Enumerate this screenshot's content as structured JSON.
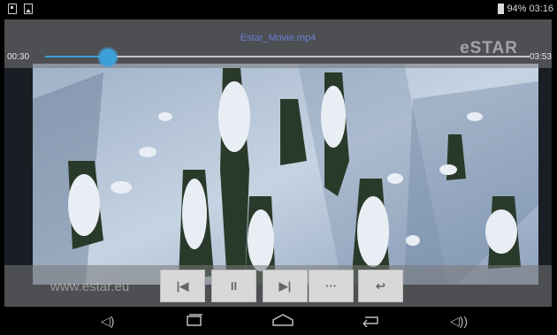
{
  "status_bar": {
    "battery": "94%",
    "time": "03:16",
    "left_icons": [
      "storage-icon",
      "image-icon"
    ]
  },
  "player": {
    "file_title": "Estar_Movie.mp4",
    "current_time": "00:30",
    "total_time": "03:53",
    "progress": 0.13,
    "logo_text": "eSTAR"
  },
  "controls": {
    "site": "www.estar.eu",
    "buttons": [
      {
        "name": "previous-button",
        "icon": "skip-previous-icon",
        "glyph": "|◀"
      },
      {
        "name": "pause-button",
        "icon": "pause-icon",
        "glyph": "II"
      },
      {
        "name": "next-button",
        "icon": "skip-next-icon",
        "glyph": "▶|"
      },
      {
        "name": "more-button",
        "icon": "more-icon",
        "glyph": "···"
      },
      {
        "name": "back-button",
        "icon": "return-icon",
        "glyph": "↩"
      }
    ]
  },
  "nav_bar": {
    "icons": [
      "volume-down-icon",
      "recent-apps-icon",
      "home-icon",
      "back-icon",
      "volume-up-icon"
    ]
  },
  "colors": {
    "accent": "#3d9fd8",
    "title": "#6a7fd6",
    "overlay": "#787878"
  }
}
